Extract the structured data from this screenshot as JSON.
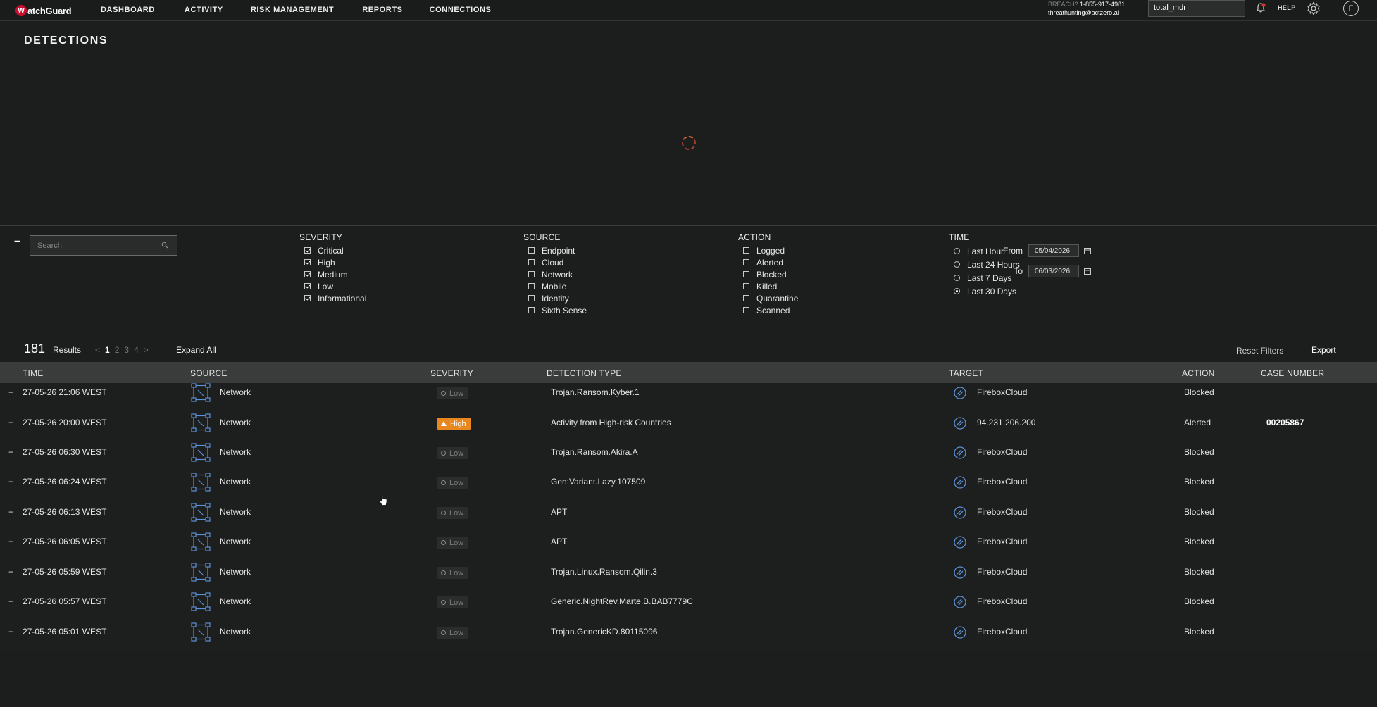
{
  "brand": {
    "logo_text": "atchGuard",
    "logo_letter": "W"
  },
  "nav": {
    "items": [
      "DASHBOARD",
      "ACTIVITY",
      "RISK MANAGEMENT",
      "REPORTS",
      "CONNECTIONS"
    ]
  },
  "header": {
    "breach_label": "BREACH?",
    "breach_phone": "1-855-917-4981",
    "email": "threathunting@actzero.ai",
    "tenant": "total_mdr",
    "help": "HELP",
    "user_initial": "F"
  },
  "page": {
    "title": "DETECTIONS"
  },
  "search": {
    "placeholder": "Search"
  },
  "filters": {
    "collapse_symbol": "−",
    "severity": {
      "title": "SEVERITY",
      "options": [
        {
          "label": "Critical",
          "checked": true
        },
        {
          "label": "High",
          "checked": true
        },
        {
          "label": "Medium",
          "checked": true
        },
        {
          "label": "Low",
          "checked": true
        },
        {
          "label": "Informational",
          "checked": true
        }
      ]
    },
    "source": {
      "title": "SOURCE",
      "options": [
        {
          "label": "Endpoint",
          "checked": false
        },
        {
          "label": "Cloud",
          "checked": false
        },
        {
          "label": "Network",
          "checked": false
        },
        {
          "label": "Mobile",
          "checked": false
        },
        {
          "label": "Identity",
          "checked": false
        },
        {
          "label": "Sixth Sense",
          "checked": false
        }
      ]
    },
    "action": {
      "title": "ACTION",
      "options": [
        {
          "label": "Logged",
          "checked": false
        },
        {
          "label": "Alerted",
          "checked": false
        },
        {
          "label": "Blocked",
          "checked": false
        },
        {
          "label": "Killed",
          "checked": false
        },
        {
          "label": "Quarantine",
          "checked": false
        },
        {
          "label": "Scanned",
          "checked": false
        }
      ]
    },
    "time": {
      "title": "TIME",
      "options": [
        {
          "label": "Last Hour",
          "selected": false
        },
        {
          "label": "Last 24 Hours",
          "selected": false
        },
        {
          "label": "Last 7 Days",
          "selected": false
        },
        {
          "label": "Last 30 Days",
          "selected": true
        }
      ],
      "from_label": "From",
      "from_value": "05/04/2026",
      "to_label": "To",
      "to_value": "06/03/2026"
    }
  },
  "results": {
    "count": "181",
    "label": "Results",
    "pager": {
      "prev": "<",
      "pages": [
        "1",
        "2",
        "3",
        "4"
      ],
      "current": "1",
      "next": ">"
    },
    "expand_all": "Expand All",
    "reset_filters": "Reset Filters",
    "export": "Export"
  },
  "table": {
    "columns": [
      "TIME",
      "SOURCE",
      "SEVERITY",
      "DETECTION TYPE",
      "TARGET",
      "ACTION",
      "CASE NUMBER"
    ],
    "expand_symbol": "+",
    "rows": [
      {
        "time": "27-05-26 21:06 WEST",
        "source": "Network",
        "severity": "Low",
        "detection": "Trojan.Ransom.Kyber.1",
        "target": "FireboxCloud",
        "action": "Blocked",
        "case": ""
      },
      {
        "time": "27-05-26 20:00 WEST",
        "source": "Network",
        "severity": "High",
        "detection": "Activity from High-risk Countries",
        "target": "94.231.206.200",
        "action": "Alerted",
        "case": "00205867"
      },
      {
        "time": "27-05-26 06:30 WEST",
        "source": "Network",
        "severity": "Low",
        "detection": "Trojan.Ransom.Akira.A",
        "target": "FireboxCloud",
        "action": "Blocked",
        "case": ""
      },
      {
        "time": "27-05-26 06:24 WEST",
        "source": "Network",
        "severity": "Low",
        "detection": "Gen:Variant.Lazy.107509",
        "target": "FireboxCloud",
        "action": "Blocked",
        "case": ""
      },
      {
        "time": "27-05-26 06:13 WEST",
        "source": "Network",
        "severity": "Low",
        "detection": "APT",
        "target": "FireboxCloud",
        "action": "Blocked",
        "case": ""
      },
      {
        "time": "27-05-26 06:05 WEST",
        "source": "Network",
        "severity": "Low",
        "detection": "APT",
        "target": "FireboxCloud",
        "action": "Blocked",
        "case": ""
      },
      {
        "time": "27-05-26 05:59 WEST",
        "source": "Network",
        "severity": "Low",
        "detection": "Trojan.Linux.Ransom.Qilin.3",
        "target": "FireboxCloud",
        "action": "Blocked",
        "case": ""
      },
      {
        "time": "27-05-26 05:57 WEST",
        "source": "Network",
        "severity": "Low",
        "detection": "Generic.NightRev.Marte.B.BAB7779C",
        "target": "FireboxCloud",
        "action": "Blocked",
        "case": ""
      },
      {
        "time": "27-05-26 05:01 WEST",
        "source": "Network",
        "severity": "Low",
        "detection": "Trojan.GenericKD.80115096",
        "target": "FireboxCloud",
        "action": "Blocked",
        "case": ""
      }
    ]
  },
  "colors": {
    "accent_high": "#e8871e",
    "logo_red": "#c8102e",
    "background": "#1c1d1d",
    "header_row": "#3a3b3b"
  },
  "icons": {
    "source": "network-topology-icon",
    "target": "firebox-link-icon",
    "search": "search-icon",
    "calendar": "calendar-icon",
    "bell": "bell-icon",
    "gear": "gear-icon"
  }
}
